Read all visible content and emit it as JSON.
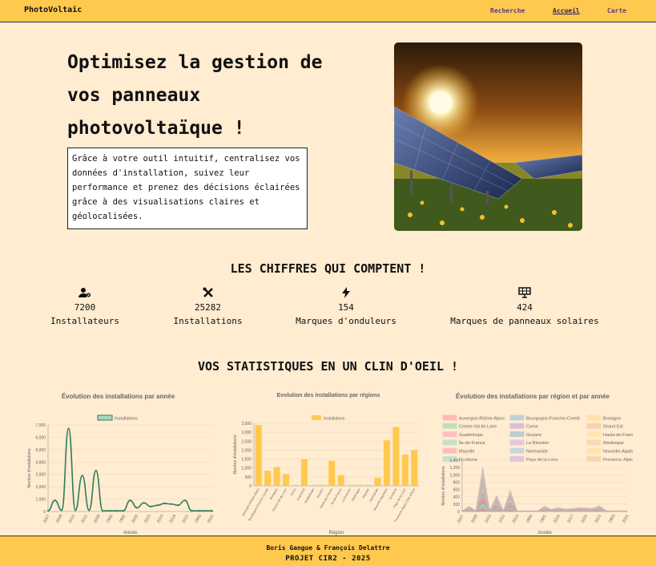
{
  "nav": {
    "brand": "PhotoVoltaïc",
    "links": [
      "Recherche",
      "Accueil",
      "Carte"
    ],
    "active": "Accueil"
  },
  "hero": {
    "title": "Optimisez la gestion de vos panneaux photovoltaïque !",
    "description": "Grâce à votre outil intuitif, centralisez vos données d'installation, suivez leur performance et prenez des décisions éclairées grâce à des visualisations claires et géolocalisées.",
    "image": "solar-panels-sunset"
  },
  "stats": {
    "title": "LES CHIFFRES QUI COMPTENT !",
    "items": [
      {
        "icon": "user-gear-icon",
        "value": "7200",
        "label": "Installateurs"
      },
      {
        "icon": "tools-icon",
        "value": "25282",
        "label": "Installations"
      },
      {
        "icon": "bolt-icon",
        "value": "154",
        "label": "Marques d'onduleurs"
      },
      {
        "icon": "solar-panel-icon",
        "value": "424",
        "label": "Marques de panneaux solaires"
      }
    ]
  },
  "charts_section": {
    "title": "VOS STATISTIQUES EN UN CLIN D'OEIL !"
  },
  "chart_data": [
    {
      "type": "line",
      "title": "Évolution des installations par année",
      "xlabel": "Année",
      "ylabel": "Nombre d'installations",
      "series": [
        {
          "name": "Installations",
          "color": "#2e7d5b",
          "values": [
            50,
            900,
            100,
            6700,
            100,
            2900,
            100,
            3300,
            50,
            50,
            50,
            50,
            900,
            300,
            700,
            400,
            500,
            650,
            600,
            500,
            900,
            50,
            50,
            50,
            50
          ]
        }
      ],
      "x_tick_labels": [
        "2007",
        "2008",
        "2010",
        "2012",
        "2009",
        "1990",
        "1992",
        "2005",
        "2015",
        "2016",
        "2019",
        "2021",
        "1993",
        "2001"
      ],
      "ylim": [
        0,
        7000
      ],
      "yticks": [
        "0",
        "1,000",
        "2,000",
        "3,000",
        "4,000",
        "5,000",
        "6,000",
        "7,000"
      ],
      "legend": "top-center"
    },
    {
      "type": "bar",
      "title": "Evolution des installations par régions",
      "xlabel": "Région",
      "ylabel": "Nombre d'installations",
      "series": [
        {
          "name": "Installations",
          "color": "#ffc94d"
        }
      ],
      "categories": [
        "Auvergne-Rhône-Alpes",
        "Bourgogne-Franche-Comté",
        "Bretagne",
        "Centre-Val de Loire",
        "Corse",
        "Grand Est",
        "Guadeloupe",
        "Guyane",
        "Hauts-de-France",
        "Île-de-France",
        "La Réunion",
        "Martinique",
        "Mayotte",
        "Normandie",
        "Nouvelle-Aquitaine",
        "Occitanie",
        "Pays de la Loire",
        "Provence-Alpes-Côte d'Azur"
      ],
      "values": [
        3400,
        850,
        1050,
        650,
        50,
        1500,
        50,
        50,
        1400,
        600,
        50,
        50,
        50,
        450,
        2550,
        3300,
        1750,
        2000
      ],
      "ylim": [
        0,
        3500
      ],
      "yticks": [
        "0",
        "500",
        "1,000",
        "1,500",
        "2,000",
        "2,500",
        "3,000",
        "3,500"
      ],
      "legend": "top-center"
    },
    {
      "type": "area",
      "title": "Évolution des installations par région et par année",
      "xlabel": "Année",
      "ylabel": "Nombre d'installations",
      "yticks": [
        "0",
        "200",
        "400",
        "600",
        "800",
        "1,000",
        "1,200",
        "1,400"
      ],
      "ylim": [
        0,
        1400
      ],
      "x_tick_labels": [
        "2007",
        "2008",
        "2010",
        "2011",
        "2013",
        "1990",
        "1991",
        "2016",
        "2017",
        "2020",
        "2021",
        "1993",
        "2001"
      ],
      "series": [
        {
          "name": "Auvergne-Rhône-Alpes",
          "color": "#ff7f8f"
        },
        {
          "name": "Bourgogne-Franche-Comté",
          "color": "#6fb3e0"
        },
        {
          "name": "Bretagne",
          "color": "#ffd878"
        },
        {
          "name": "Centre-Val de Loire",
          "color": "#6fcfb0"
        },
        {
          "name": "Corse",
          "color": "#b08be0"
        },
        {
          "name": "Grand Est",
          "color": "#ffb07a"
        },
        {
          "name": "Guadeloupe",
          "color": "#ff8fa3"
        },
        {
          "name": "Guyane",
          "color": "#6fa8dc"
        },
        {
          "name": "Hauts-de-France",
          "color": "#ffe08a"
        },
        {
          "name": "Île-de-France",
          "color": "#7fd3c0"
        },
        {
          "name": "La Réunion",
          "color": "#c39be8"
        },
        {
          "name": "Martinique",
          "color": "#ffbe8a"
        },
        {
          "name": "Mayotte",
          "color": "#ff8a9a"
        },
        {
          "name": "Normandie",
          "color": "#8abfe6"
        },
        {
          "name": "Nouvelle-Aquitaine",
          "color": "#ffd98a"
        },
        {
          "name": "Occitanie",
          "color": "#7ed6c4"
        },
        {
          "name": "Pays de la Loire",
          "color": "#b995e6"
        },
        {
          "name": "Provence-Alpes-Côte d'Azur",
          "color": "#ffb787"
        }
      ],
      "values": [
        20,
        150,
        30,
        1250,
        30,
        450,
        30,
        600,
        20,
        20,
        20,
        20,
        150,
        60,
        110,
        70,
        80,
        110,
        100,
        90,
        160,
        20,
        20,
        20,
        20
      ],
      "legend": "top"
    }
  ],
  "footer": {
    "authors": "Boris Gangue & François Delattre",
    "project": "PROJET CIR2 - 2025"
  }
}
